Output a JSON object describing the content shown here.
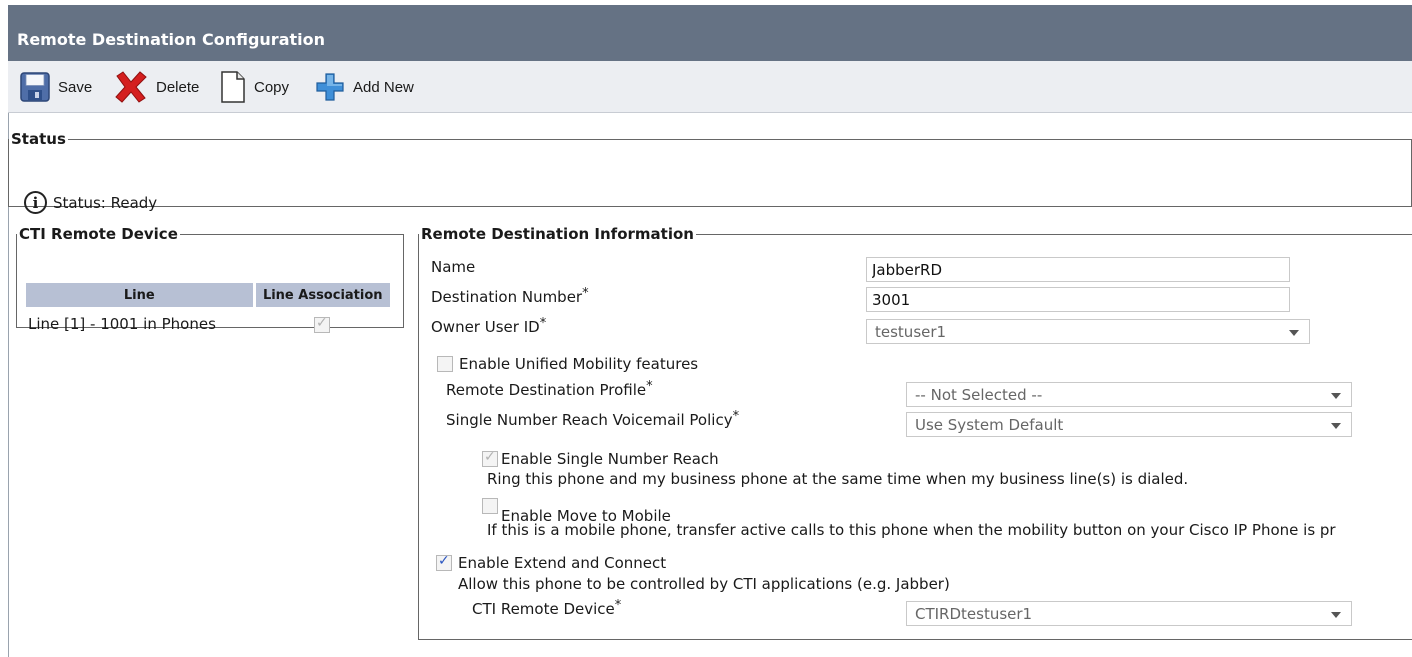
{
  "title": "Remote Destination Configuration",
  "toolbar": {
    "save": "Save",
    "delete": "Delete",
    "copy": "Copy",
    "add_new": "Add New"
  },
  "status": {
    "legend": "Status",
    "text": "Status: Ready",
    "icon": "info-icon"
  },
  "cti_remote_device": {
    "legend": "CTI Remote Device",
    "columns": [
      "Line",
      "Line Association"
    ],
    "rows": [
      {
        "line": "Line [1] - 1001 in Phones",
        "association_checked": true
      }
    ]
  },
  "rdi": {
    "legend": "Remote Destination Information",
    "name_label": "Name",
    "name_value": "JabberRD",
    "dest_label": "Destination Number",
    "dest_value": "3001",
    "owner_label": "Owner User ID",
    "owner_value": "testuser1",
    "required_mark": "*",
    "unified_mobility_label": "Enable Unified Mobility features",
    "unified_mobility_checked": false,
    "rdp_label": "Remote Destination Profile",
    "rdp_value": "-- Not Selected --",
    "snr_vm_label": "Single Number Reach Voicemail Policy",
    "snr_vm_value": "Use System Default",
    "snr_label": "Enable Single Number Reach",
    "snr_checked": true,
    "snr_desc": "Ring this phone and my business phone at the same time when my business line(s) is dialed.",
    "mtm_label": "Enable Move to Mobile",
    "mtm_checked": false,
    "mtm_desc": "If this is a mobile phone, transfer active calls to this phone when the mobility button on your Cisco IP Phone is pr",
    "ext_label": "Enable Extend and Connect",
    "ext_checked": true,
    "ext_desc": "Allow this phone to be controlled by CTI applications (e.g. Jabber)",
    "cti_rd_label": "CTI Remote Device",
    "cti_rd_value": "CTIRDtestuser1"
  },
  "colors": {
    "title_bar": "#657284",
    "toolbar_bg": "#eceef2",
    "table_header": "#b7c0d4",
    "delete_red": "#d41f1f",
    "add_blue": "#3f8fd8"
  }
}
